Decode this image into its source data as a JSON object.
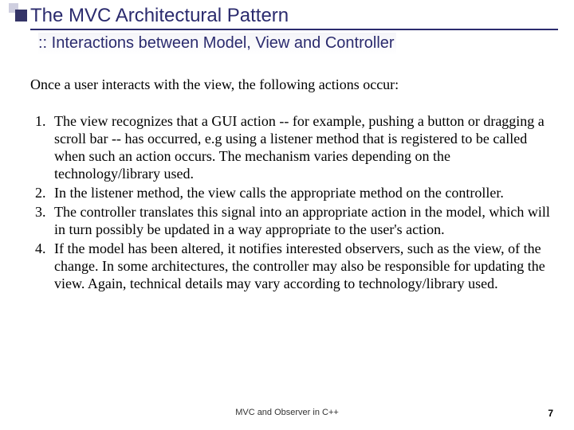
{
  "header": {
    "title": "The MVC Architectural Pattern",
    "subtitle": ":: Interactions between Model, View and Controller"
  },
  "intro": "Once a user interacts with the view, the following actions occur:",
  "points": [
    "The view recognizes that a GUI action -- for example, pushing a button or dragging a scroll bar -- has occurred, e.g using a listener method that is registered to be called when such an action occurs. The mechanism varies depending on the technology/library used.",
    "In the listener method, the view calls the appropriate method on the controller.",
    "The controller translates this signal into an appropriate action in the model, which will in turn possibly be updated in a way appropriate to the user's action.",
    "If the model has been altered, it notifies interested observers, such as the view, of the change. In some architectures, the controller may also be responsible for updating the view. Again, technical details may vary according to technology/library used."
  ],
  "footer": {
    "center": "MVC and Observer in C++",
    "page": "7"
  }
}
